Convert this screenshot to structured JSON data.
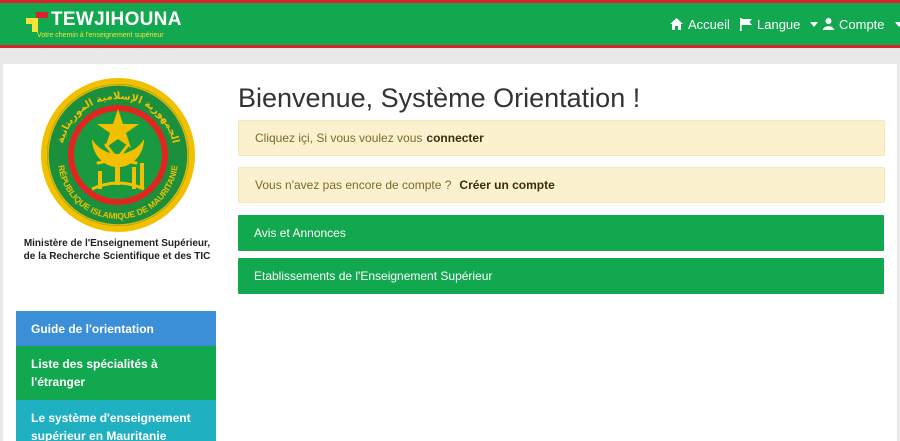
{
  "brand": {
    "name": "TEWJIHOUNA",
    "tagline": "Votre chemin à l'enseignement supérieur"
  },
  "nav": {
    "home_label": "Accueil",
    "language_label": "Langue",
    "account_label": "Compte"
  },
  "seal": {
    "arabic_ring": "الجمهورية الإسلامية الموريتانية",
    "french_ring": "RÉPUBLIQUE ISLAMIQUE DE MAURITANIE"
  },
  "ministry": {
    "line1": "Ministère de l'Enseignement Supérieur,",
    "line2": "de la Recherche Scientifique et des TIC"
  },
  "side_menu": {
    "items": [
      {
        "label": "Guide de l'orientation"
      },
      {
        "label": "Liste des spécialités à l'étranger"
      },
      {
        "label": "Le système d'enseignement supérieur en Mauritanie"
      }
    ]
  },
  "main": {
    "welcome": "Bienvenue, Système Orientation !",
    "login_prompt": "Cliquez içi, Si vous voulez vous",
    "login_link": "connecter",
    "signup_prompt": "Vous n'avez pas encore de compte ?",
    "signup_link": "Créer un compte",
    "panels": [
      {
        "label": "Avis et Annonces"
      },
      {
        "label": "Etablissements de l'Enseignement Supérieur"
      }
    ]
  },
  "colors": {
    "header_green": "#11a84f",
    "header_red": "#d8232a",
    "tagline_yellow": "#f7e23a",
    "menu_blue": "#3a8fd7",
    "menu_teal": "#1fb0c2",
    "alert_bg": "#fcf1cf"
  },
  "icons": {
    "home": "home-icon",
    "language": "flag-icon",
    "account": "user-icon"
  }
}
